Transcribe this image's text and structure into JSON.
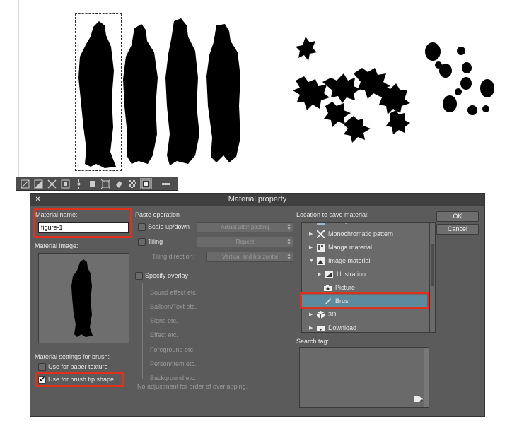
{
  "toolbar": {
    "icons": [
      "transform-icon",
      "flip-icon",
      "scale-icon",
      "grid-icon",
      "move-icon",
      "rotate-icon",
      "free-transform-icon",
      "fill-icon",
      "pattern-icon",
      "register-material-icon",
      "collapse-icon"
    ]
  },
  "dialog": {
    "title": "Material property",
    "close": "×",
    "material_name_label": "Material name:",
    "material_name_value": "figure-1",
    "material_image_label": "Material image:",
    "brush_settings_label": "Material settings for brush:",
    "paper_texture_label": "Use for paper texture",
    "paper_texture_checked": false,
    "brush_tip_label": "Use for brush tip shape",
    "brush_tip_checked": true,
    "paste": {
      "heading": "Paste operation",
      "scale_label": "Scale up/down",
      "adjust_button": "Adjust after pasting",
      "tiling_label": "Tiling",
      "repeat_button": "Repeat",
      "tiling_direction_label": "Tiling direction:",
      "direction_value": "Vertical and horizontal",
      "overlay_label": "Specify overlay",
      "overlay_items": [
        "Sound effect etc.",
        "Balloon/Text etc.",
        "Signs etc.",
        "Effect etc.",
        "Foreground etc.",
        "Person/Item etc.",
        "Background etc."
      ],
      "no_adjust_note": "No adjustment for order of overlapping."
    },
    "location": {
      "label": "Location to save material:",
      "items": [
        {
          "label": "Color pattern"
        },
        {
          "label": "Monochromatic pattern"
        },
        {
          "label": "Manga material"
        },
        {
          "label": "Image material"
        },
        {
          "label": "Illustration"
        },
        {
          "label": "Picture"
        },
        {
          "label": "Brush",
          "selected": true
        },
        {
          "label": "3D"
        },
        {
          "label": "Download"
        }
      ]
    },
    "search_tag_label": "Search tag:",
    "ok": "OK",
    "cancel": "Cancel"
  },
  "colors": {
    "highlight": "#e0301e",
    "selected_row": "#5d8a9d",
    "dialog_bg": "#5b5b5b"
  }
}
